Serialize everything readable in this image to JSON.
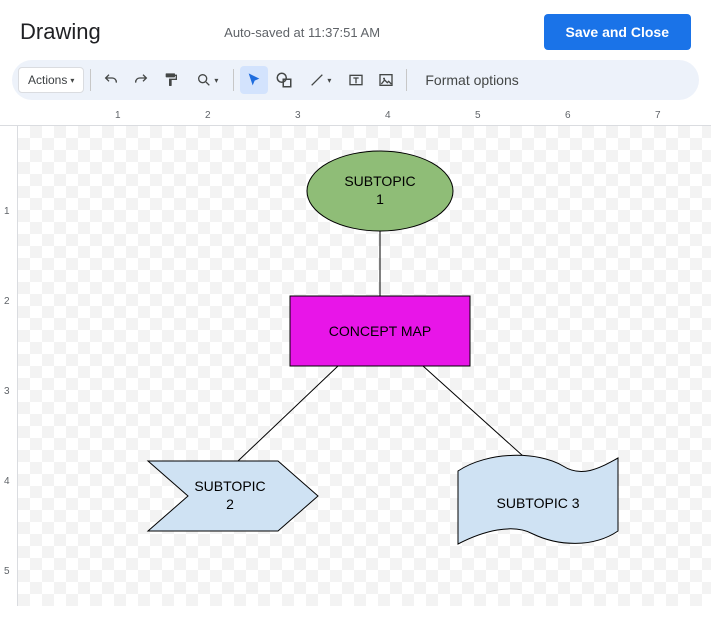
{
  "header": {
    "title": "Drawing",
    "status": "Auto-saved at 11:37:51 AM",
    "save_button": "Save and Close"
  },
  "toolbar": {
    "actions_label": "Actions",
    "format_options": "Format options"
  },
  "ruler": {
    "h": [
      "1",
      "2",
      "3",
      "4",
      "5",
      "6",
      "7"
    ],
    "v": [
      "1",
      "2",
      "3",
      "4",
      "5"
    ]
  },
  "shapes": {
    "subtopic1_line1": "SUBTOPIC",
    "subtopic1_line2": "1",
    "concept_map": "CONCEPT MAP",
    "subtopic2_line1": "SUBTOPIC",
    "subtopic2_line2": "2",
    "subtopic3": "SUBTOPIC 3"
  },
  "colors": {
    "ellipse_fill": "#8fbd77",
    "rect_fill": "#e815e8",
    "shape_blue": "#cfe2f3",
    "stroke": "#000000"
  }
}
